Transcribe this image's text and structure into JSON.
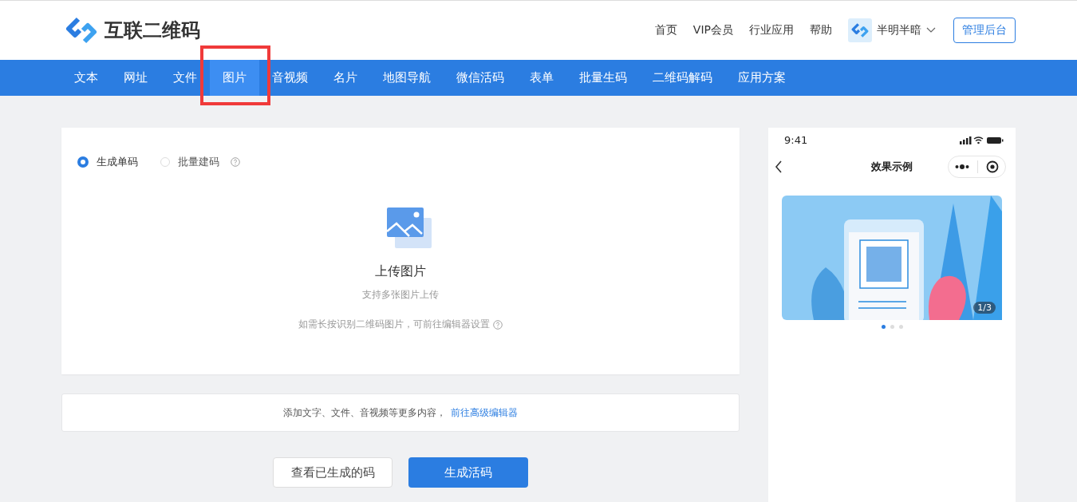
{
  "header": {
    "brand": "互联二维码",
    "links": [
      "首页",
      "VIP会员",
      "行业应用",
      "帮助"
    ],
    "user": {
      "name": "半明半暗"
    },
    "admin_button": "管理后台"
  },
  "tabs": [
    {
      "label": "文本",
      "selected": false,
      "highlighted": false
    },
    {
      "label": "网址",
      "selected": false,
      "highlighted": false
    },
    {
      "label": "文件",
      "selected": false,
      "highlighted": false
    },
    {
      "label": "图片",
      "selected": true,
      "highlighted": true
    },
    {
      "label": "音视频",
      "selected": false,
      "highlighted": false
    },
    {
      "label": "名片",
      "selected": false,
      "highlighted": false
    },
    {
      "label": "地图导航",
      "selected": false,
      "highlighted": false
    },
    {
      "label": "微信活码",
      "selected": false,
      "highlighted": false
    },
    {
      "label": "表单",
      "selected": false,
      "highlighted": false
    },
    {
      "label": "批量生码",
      "selected": false,
      "highlighted": false
    },
    {
      "label": "二维码解码",
      "selected": false,
      "highlighted": false
    },
    {
      "label": "应用方案",
      "selected": false,
      "highlighted": false
    }
  ],
  "modes": [
    {
      "label": "生成单码",
      "selected": true,
      "help": false
    },
    {
      "label": "批量建码",
      "selected": false,
      "help": true
    }
  ],
  "upload": {
    "title": "上传图片",
    "subtitle": "支持多张图片上传",
    "note": "如需长按识别二维码图片，可前往编辑器设置"
  },
  "editor_bar": {
    "text": "添加文字、文件、音视频等更多内容，",
    "link": "前往高级编辑器"
  },
  "actions": {
    "secondary": "查看已生成的码",
    "primary": "生成活码"
  },
  "preview": {
    "time": "9:41",
    "title": "效果示例",
    "counter": "1/3",
    "dots": [
      {
        "selected": true
      },
      {
        "selected": false
      },
      {
        "selected": false
      }
    ]
  }
}
